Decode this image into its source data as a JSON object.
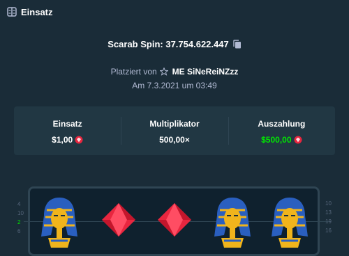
{
  "header": {
    "title": "Einsatz"
  },
  "game": {
    "id_label": "Scarab Spin: 37.754.622.447"
  },
  "placed": {
    "prefix": "Platziert von",
    "user": "ME SiNeReiNZzz",
    "date": "Am 7.3.2021 um 03:49"
  },
  "stats": {
    "bet_label": "Einsatz",
    "bet_value": "$1,00",
    "mult_label": "Multiplikator",
    "mult_value": "500,00×",
    "payout_label": "Auszahlung",
    "payout_value": "$500,00"
  },
  "paylines": {
    "left": [
      "4",
      "10",
      "2",
      "6"
    ],
    "right": [
      "10",
      "13",
      "19",
      "16"
    ]
  },
  "reels": [
    "pharaoh",
    "red-gem",
    "red-gem",
    "pharaoh",
    "pharaoh"
  ],
  "colors": {
    "win": "#00e701",
    "gem": "#e8263f",
    "gold": "#f0b41c",
    "blue": "#2a5fbf"
  }
}
